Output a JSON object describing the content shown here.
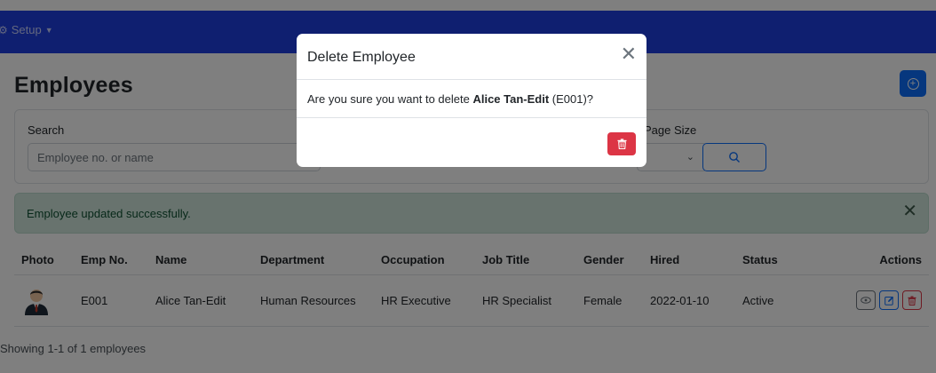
{
  "navbar": {
    "setup_label": "Setup",
    "gear_icon": "gear-icon",
    "caret_icon": "caret-down-icon"
  },
  "page": {
    "title": "Employees",
    "add_icon": "plus-circle-icon"
  },
  "search": {
    "label": "Search",
    "placeholder": "Employee no. or name",
    "page_size_label": "Page Size",
    "page_size_value": "",
    "search_icon": "search-icon"
  },
  "alert": {
    "message": "Employee updated successfully.",
    "close_icon": "close-icon",
    "color": "#d1e7dd"
  },
  "table": {
    "headers": [
      "Photo",
      "Emp No.",
      "Name",
      "Department",
      "Occupation",
      "Job Title",
      "Gender",
      "Hired",
      "Status",
      "Actions"
    ],
    "rows": [
      {
        "photo_icon": "employee-avatar",
        "emp_no": "E001",
        "name": "Alice Tan-Edit",
        "department": "Human Resources",
        "occupation": "HR Executive",
        "job_title": "HR Specialist",
        "gender": "Female",
        "hired": "2022-01-10",
        "status": "Active",
        "actions": [
          "view-icon",
          "edit-icon",
          "delete-icon"
        ]
      }
    ]
  },
  "footer": {
    "summary": "Showing 1-1 of 1 employees"
  },
  "modal": {
    "title": "Delete Employee",
    "body_prefix": "Are you sure you want to delete ",
    "body_name": "Alice Tan-Edit",
    "body_suffix": " (E001)?",
    "close_icon": "close-icon",
    "delete_icon": "trash-icon"
  },
  "colors": {
    "navbar": "#1f3fe0",
    "primary": "#0d6efd",
    "danger": "#dc3545",
    "alert_bg": "#d1e7dd"
  }
}
